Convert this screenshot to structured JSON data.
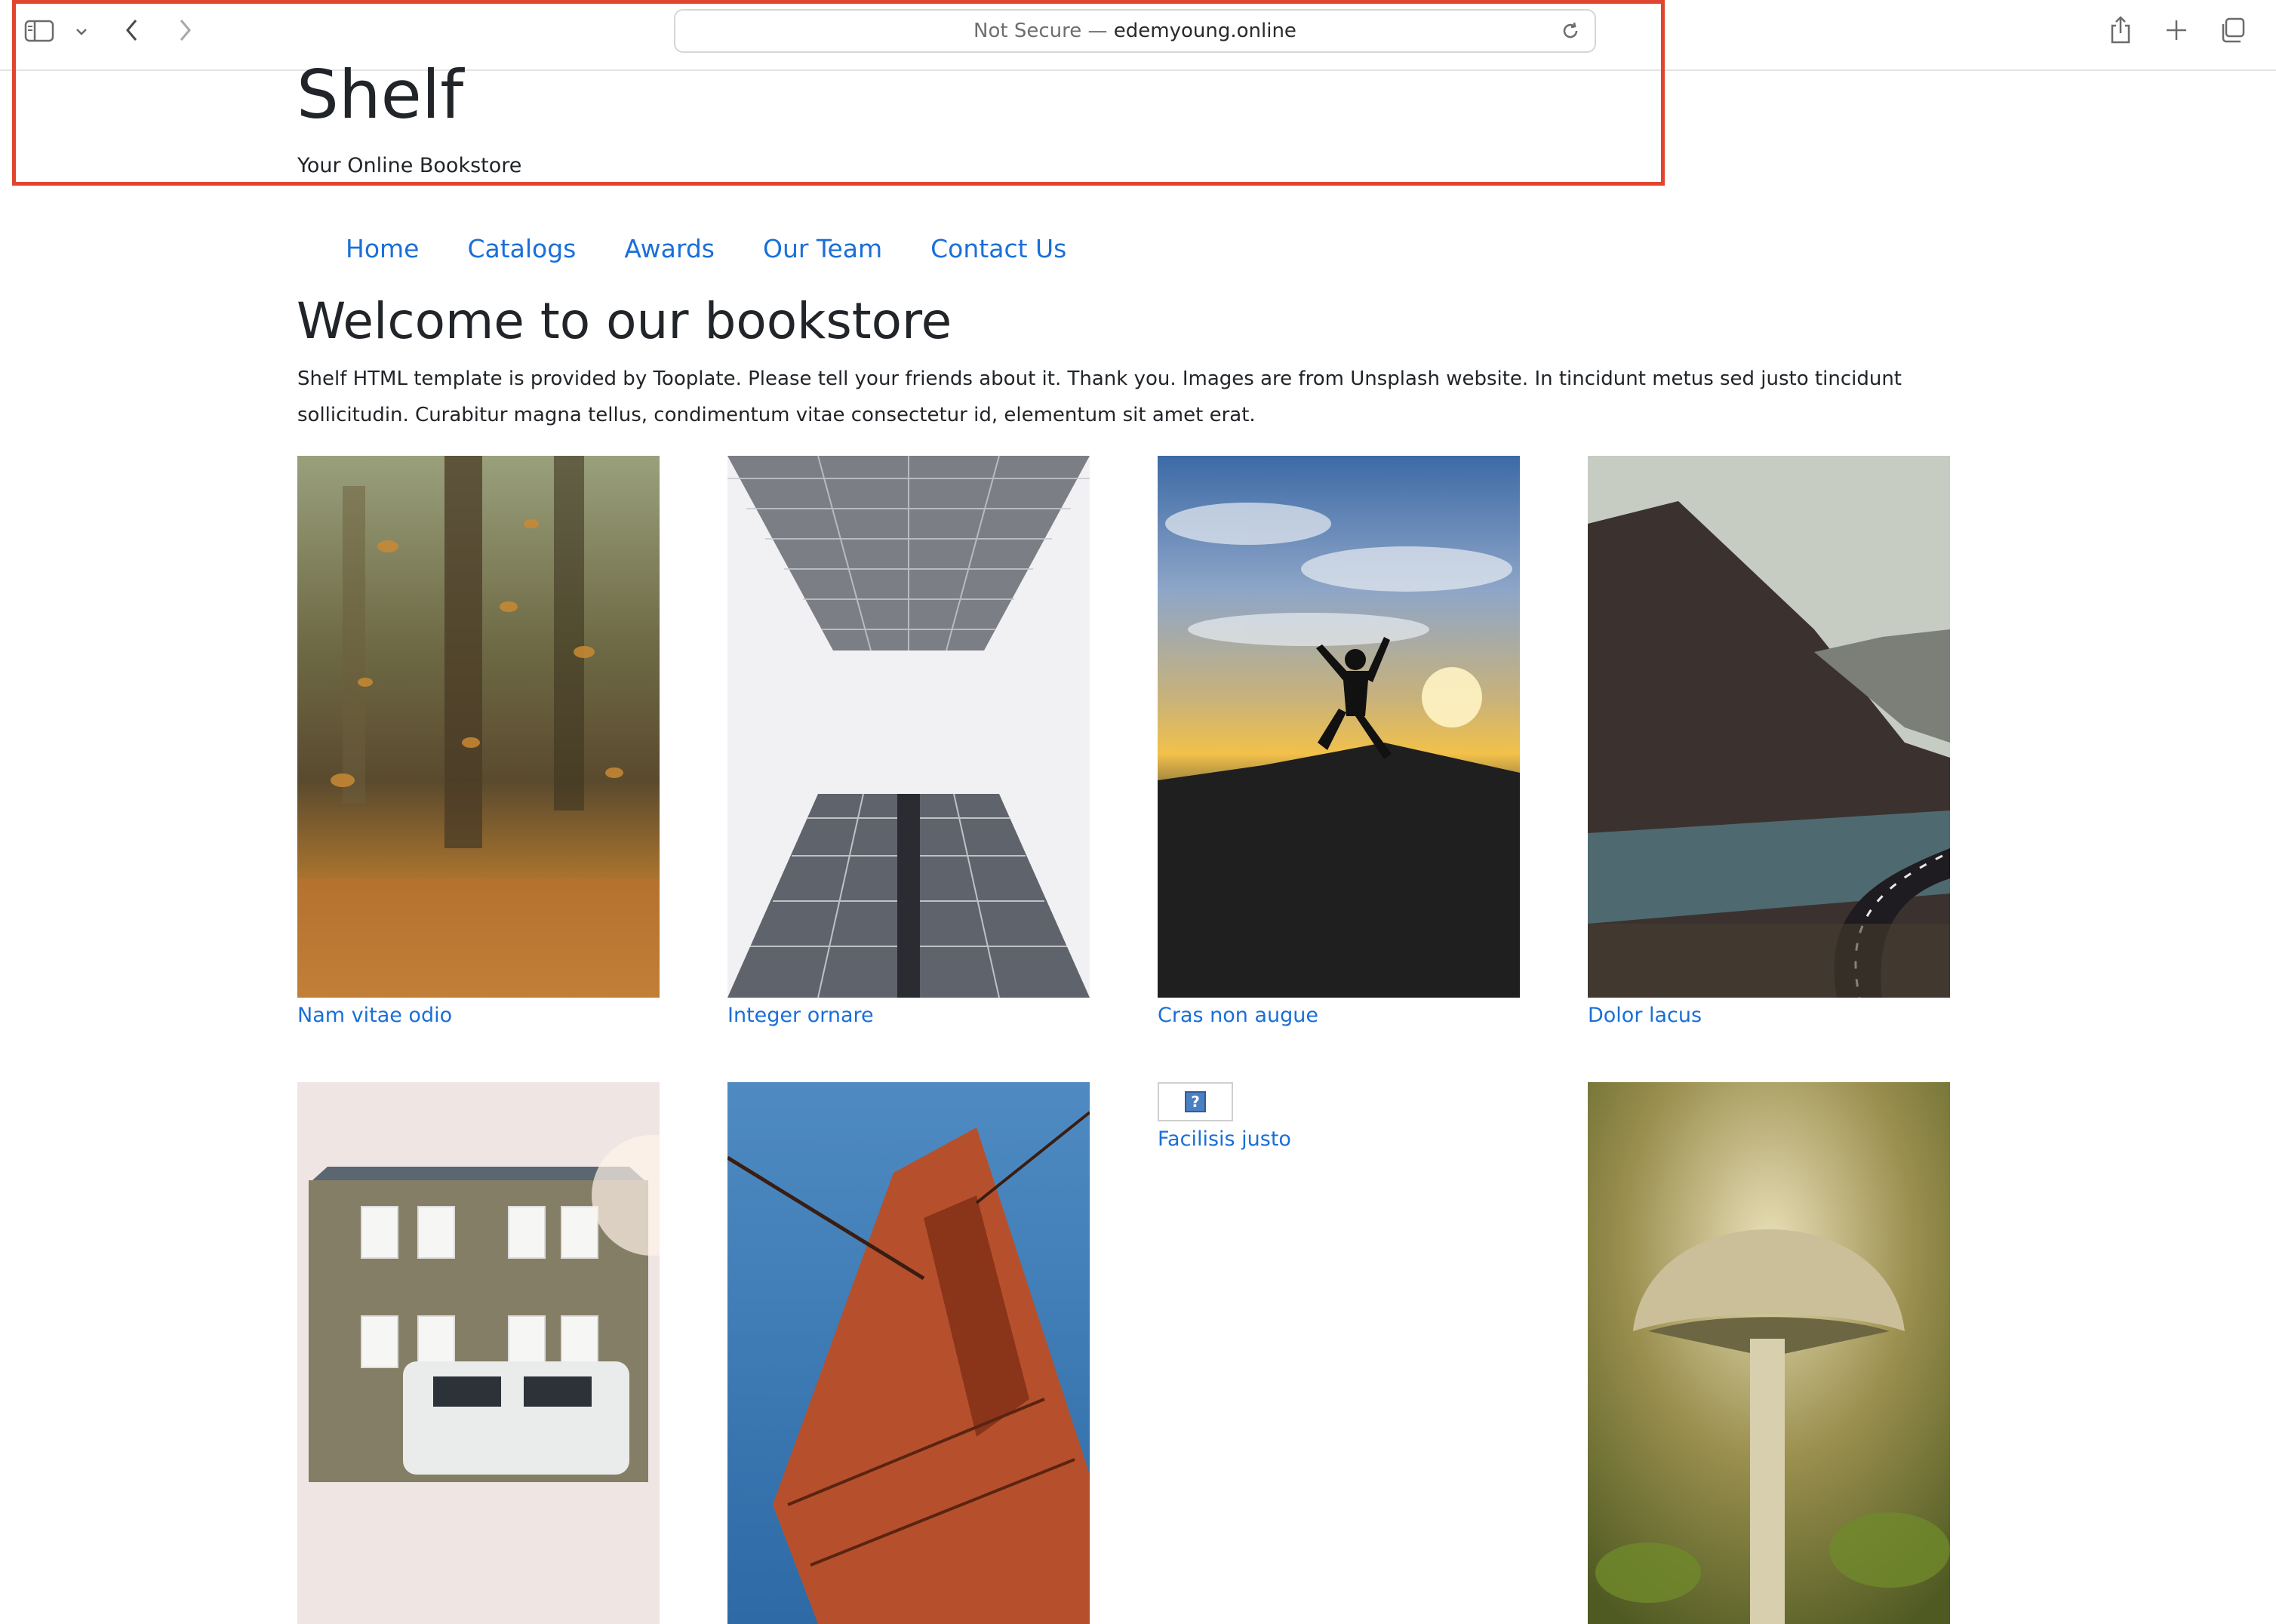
{
  "browser": {
    "security_label": "Not Secure —",
    "domain": "edemyoung.online"
  },
  "header": {
    "title": "Shelf",
    "tagline": "Your Online Bookstore"
  },
  "nav": {
    "items": [
      {
        "label": "Home"
      },
      {
        "label": "Catalogs"
      },
      {
        "label": "Awards"
      },
      {
        "label": "Our Team"
      },
      {
        "label": "Contact Us"
      }
    ]
  },
  "main": {
    "heading": "Welcome to our bookstore",
    "intro": "Shelf HTML template is provided by Tooplate. Please tell your friends about it. Thank you. Images are from Unsplash website. In tincidunt metus sed justo tincidunt sollicitudin. Curabitur magna tellus, condimentum vitae consectetur id, elementum sit amet erat."
  },
  "gallery": {
    "items": [
      {
        "caption": "Nam vitae odio",
        "image": "autumn-leaves-photo"
      },
      {
        "caption": "Integer ornare",
        "image": "skyscraper-photo"
      },
      {
        "caption": "Cras non augue",
        "image": "sunset-jump-photo"
      },
      {
        "caption": "Dolor lacus",
        "image": "mountain-road-photo"
      },
      {
        "caption": "",
        "image": "house-photo"
      },
      {
        "caption": "",
        "image": "bridge-photo"
      },
      {
        "caption": "Facilisis justo",
        "image": "broken-image"
      },
      {
        "caption": "",
        "image": "mushroom-photo"
      }
    ]
  },
  "colors": {
    "link": "#1a6fd8",
    "text": "#212529",
    "highlight": "#e2452f"
  }
}
